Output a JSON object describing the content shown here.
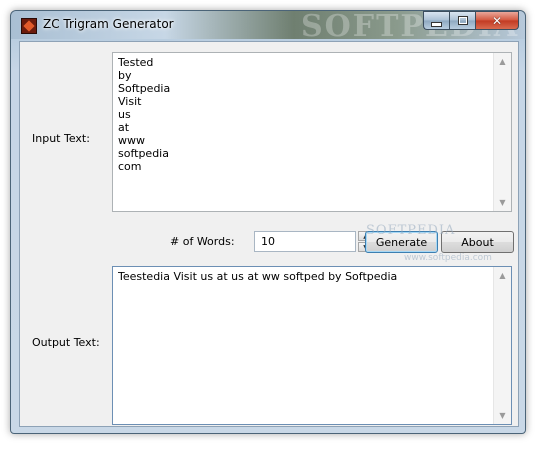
{
  "window": {
    "title": "ZC Trigram Generator",
    "watermark": "SOFTPEDIA",
    "controls": {
      "minimize": "minimize",
      "maximize": "maximize",
      "close": "close"
    }
  },
  "input": {
    "label": "Input Text:",
    "value": "Tested\nby\nSoftpedia\nVisit\nus\nat\nwww\nsoftpedia\ncom"
  },
  "words": {
    "label": "# of Words:",
    "value": "10"
  },
  "buttons": {
    "generate": "Generate",
    "about": "About"
  },
  "output": {
    "label": "Output Text:",
    "value": "Teestedia Visit us at us at ww softped by Softpedia"
  },
  "overlay": {
    "softpedia_mark": "SOFTPEDIA",
    "softpedia_url": "www.softpedia.com"
  },
  "colors": {
    "titlebar": "#a9bfd3",
    "client_bg": "#f0f0f0",
    "default_button_border": "#3c7fb1",
    "close_button": "#c23a22"
  }
}
